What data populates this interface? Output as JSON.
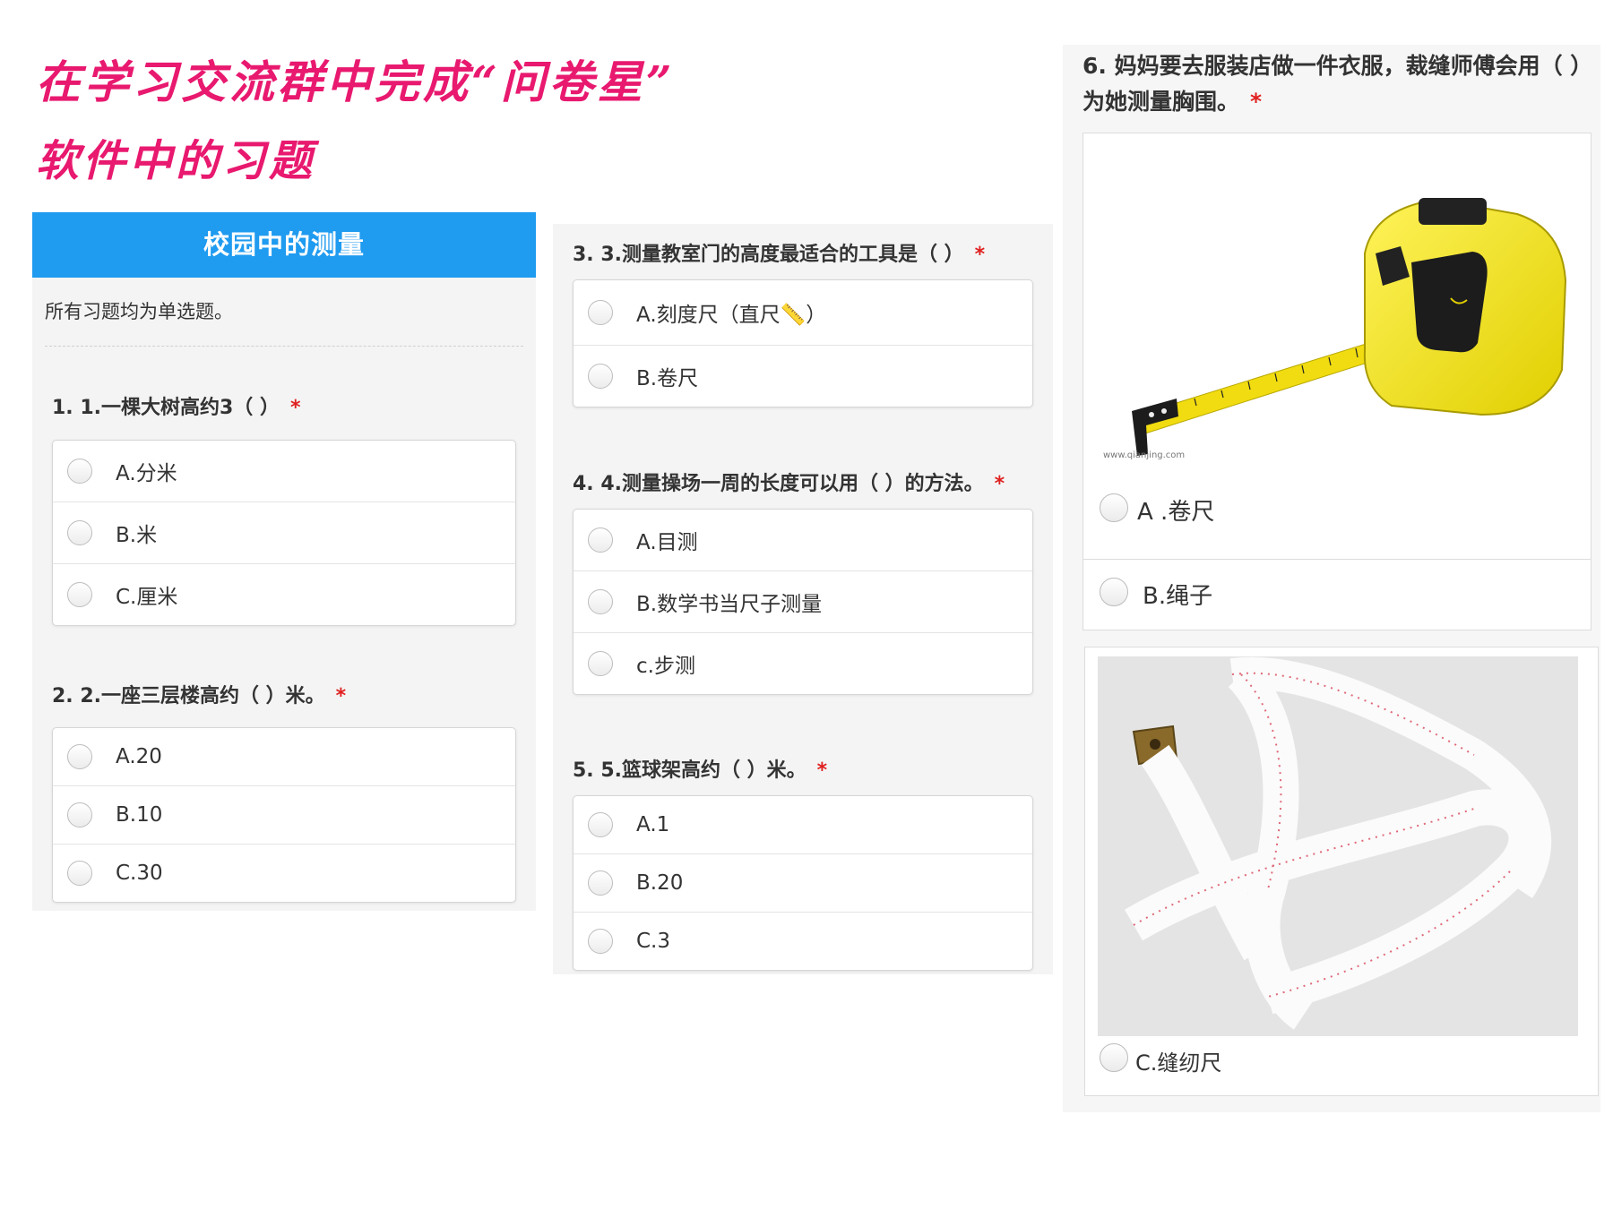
{
  "banner": {
    "line1": "在学习交流群中完成“问卷星”",
    "line2": "软件中的习题"
  },
  "survey": {
    "title": "校园中的测量",
    "description": "所有习题均为单选题。",
    "required_mark": "*"
  },
  "questions": [
    {
      "number": "1. 1.一棵大树高约3（ ）",
      "options": [
        "A.分米",
        "B.米",
        "C.厘米"
      ]
    },
    {
      "number": "2. 2.一座三层楼高约（ ）米。",
      "options": [
        "A.20",
        "B.10",
        "C.30"
      ]
    },
    {
      "number": "3. 3.测量教室门的高度最适合的工具是（ ）",
      "options": [
        "A.刻度尺（直尺📏）",
        "B.卷尺"
      ]
    },
    {
      "number": "4. 4.测量操场一周的长度可以用（ ）的方法。",
      "options": [
        "A.目测",
        "B.数学书当尺子测量",
        "c.步测"
      ]
    },
    {
      "number": "5. 5.篮球架高约（ ）米。",
      "options": [
        "A.1",
        "B.20",
        "C.3"
      ]
    },
    {
      "number": "6. 妈妈要去服装店做一件衣服，裁缝师傅会用（ ）为她测量胸围。",
      "options": [
        "A .卷尺",
        "B.绳子",
        "C.缝纫尺"
      ]
    }
  ],
  "images": {
    "tape_measure_watermark": "www.qianjing.com"
  },
  "colors": {
    "banner_text": "#e8196f",
    "header_bg": "#1f9bf0",
    "required": "#e02020"
  }
}
